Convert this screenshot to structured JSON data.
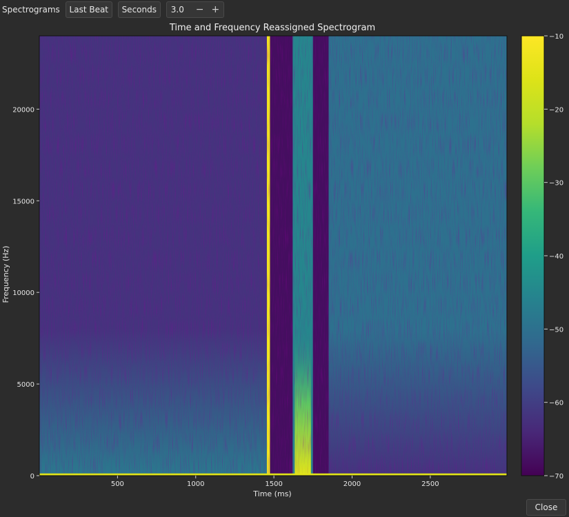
{
  "toolbar": {
    "label": "Spectrograms",
    "last_beat_label": "Last Beat",
    "seconds_label": "Seconds",
    "seconds_value": "3.0",
    "decrement_label": "−",
    "increment_label": "+"
  },
  "chart_data": {
    "type": "heatmap",
    "title": "Time and Frequency Reassigned Spectrogram",
    "xlabel": "Time (ms)",
    "ylabel": "Frequency (Hz)",
    "xlim": [
      0,
      2990
    ],
    "ylim": [
      0,
      24000
    ],
    "x_ticks": [
      500,
      1000,
      1500,
      2000,
      2500
    ],
    "y_ticks": [
      0,
      5000,
      10000,
      15000,
      20000
    ],
    "colorbar": {
      "ticks": [
        -10,
        -20,
        -30,
        -40,
        -50,
        -60,
        -70
      ],
      "range": [
        -70,
        -10
      ],
      "colormap": "viridis"
    },
    "regions": [
      {
        "t_start": 0,
        "t_end": 1460,
        "level_db": -62,
        "low_freq_level_db": -48
      },
      {
        "t_start": 1455,
        "t_end": 1475,
        "level_db": -12
      },
      {
        "t_start": 1475,
        "t_end": 1620,
        "level_db": -68
      },
      {
        "t_start": 1620,
        "t_end": 1750,
        "level_db": -45,
        "burst_level_db": -15,
        "burst_freq_max": 8000
      },
      {
        "t_start": 1750,
        "t_end": 1850,
        "level_db": -68
      },
      {
        "t_start": 1850,
        "t_end": 2990,
        "level_db": -50,
        "low_freq_level_db": -62
      }
    ]
  },
  "close_label": "Close"
}
